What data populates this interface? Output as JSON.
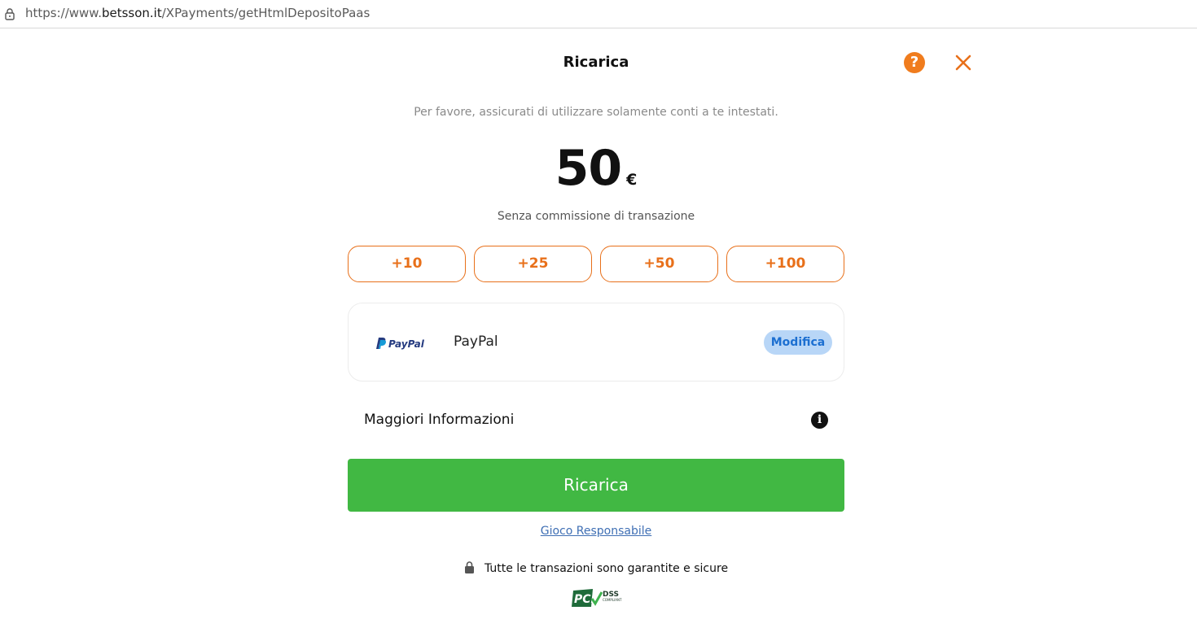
{
  "browser": {
    "url_prefix": "https://www.",
    "url_domain": "betsson.it",
    "url_path": "/XPayments/getHtmlDepositoPaas",
    "lock_icon": "padlock-icon"
  },
  "header": {
    "title": "Ricarica",
    "help_label": "?",
    "help_icon": "question-circle-icon",
    "close_icon": "close-x-icon",
    "accent_color": "#f07c1d"
  },
  "notice": "Per favore, assicurati di utilizzare solamente conti a te intestati.",
  "amount": {
    "value": "50",
    "currency": "€",
    "fee_note": "Senza commissione di transazione"
  },
  "quick_amounts": [
    "+10",
    "+25",
    "+50",
    "+100"
  ],
  "payment_method": {
    "logo_text": "PayPal",
    "name": "PayPal",
    "edit_label": "Modifica"
  },
  "more_info": {
    "label": "Maggiori Informazioni",
    "icon_label": "i",
    "icon": "info-icon"
  },
  "submit": {
    "label": "Ricarica",
    "color": "#41b843"
  },
  "footer": {
    "responsible_link": "Gioco Responsabile",
    "secure_text": "Tutte le transazioni sono garantite e sicure",
    "pci_text": "PCI",
    "pci_dss_text": "DSS",
    "pci_compliant_text": "COMPLIANT"
  }
}
